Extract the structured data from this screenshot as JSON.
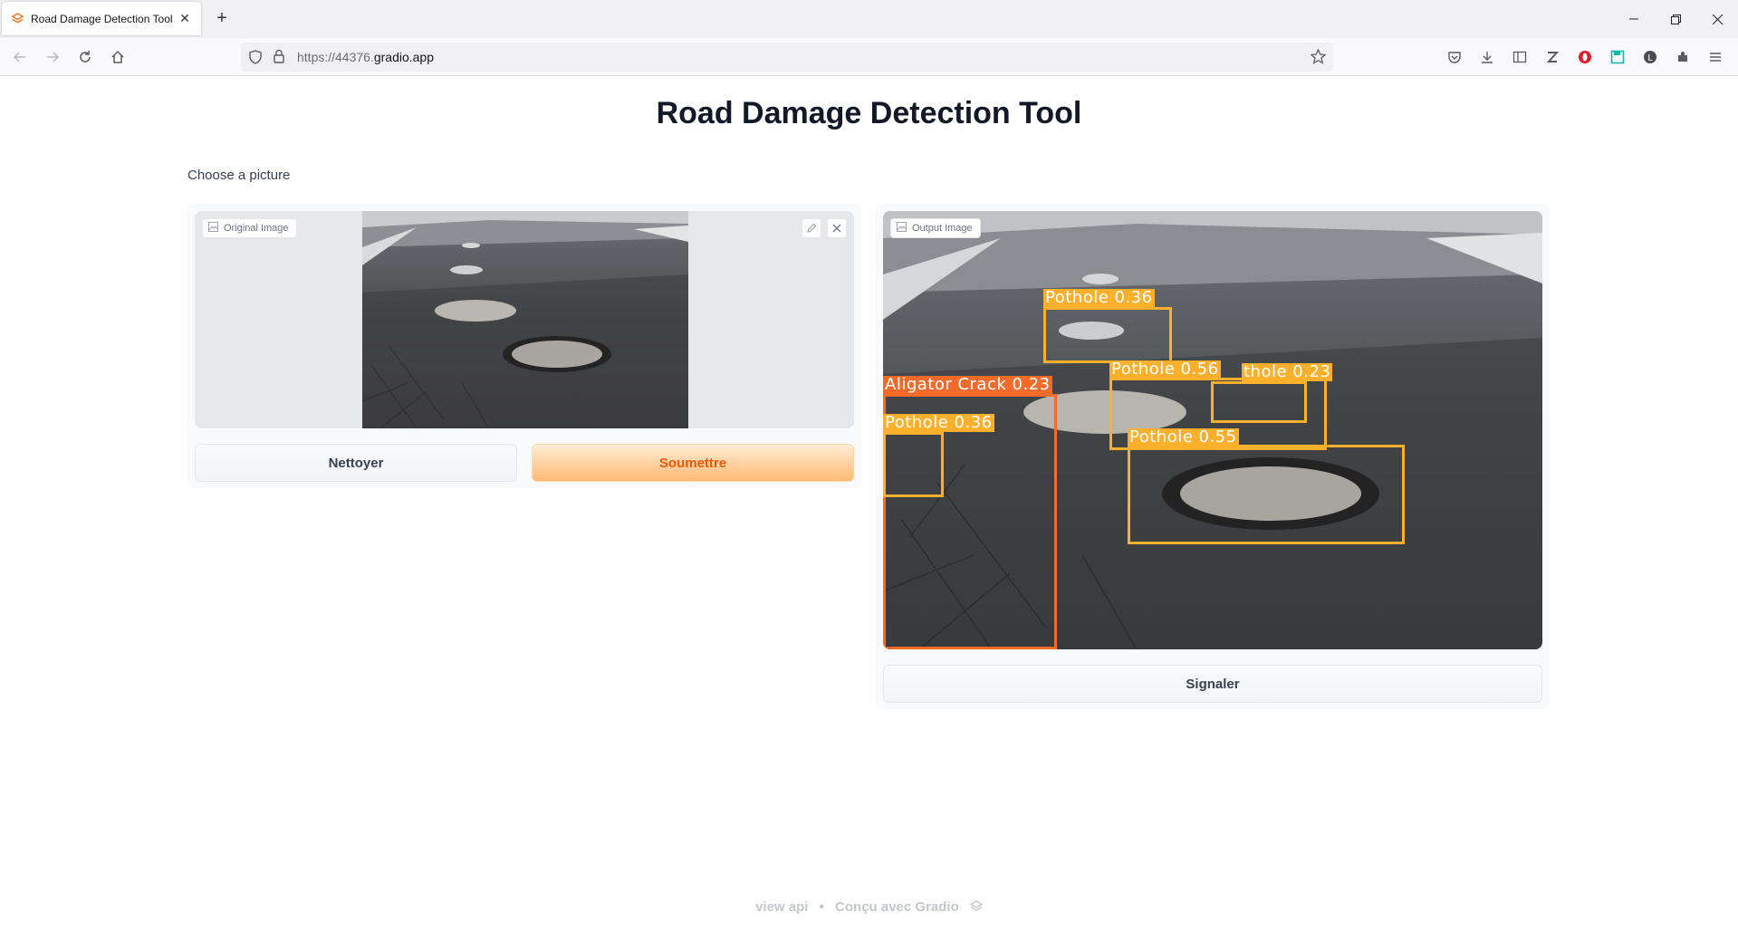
{
  "browser": {
    "tab_title": "Road Damage Detection Tool",
    "url_prefix": "https://44376.",
    "url_domain": "gradio.app"
  },
  "page": {
    "title": "Road Damage Detection Tool",
    "subtitle": "Choose a picture"
  },
  "input_panel": {
    "label": "Original Image",
    "clear_button": "Nettoyer",
    "submit_button": "Soumettre"
  },
  "output_panel": {
    "label": "Output Image",
    "flag_button": "Signaler",
    "detections": [
      {
        "label": "Pothole 0.36"
      },
      {
        "label": "Pothole 0.56"
      },
      {
        "label": "thole 0.23"
      },
      {
        "label": "Aligator Crack 0.23"
      },
      {
        "label": "Pothole 0.36"
      },
      {
        "label": "Pothole 0.55"
      }
    ]
  },
  "footer": {
    "api_link": "view api",
    "separator": "•",
    "built_with": "Conçu avec Gradio"
  },
  "colors": {
    "primary_button_text": "#ea580c",
    "pothole_box": "#fbb02d",
    "crack_box": "#f26b2a"
  }
}
